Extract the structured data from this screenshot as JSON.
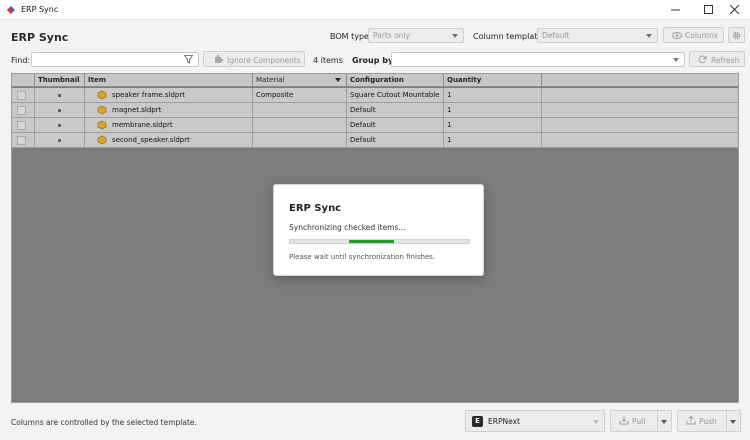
{
  "window": {
    "title": "ERP Sync"
  },
  "header": {
    "app_title": "ERP Sync",
    "bom_type_label": "BOM type:",
    "bom_type_value": "Parts only",
    "column_template_label": "Column template:",
    "column_template_value": "Default",
    "columns_button": "Columns"
  },
  "findbar": {
    "find_label": "Find:",
    "find_value": "",
    "ignore_button": "Ignore Components",
    "item_count": "4 items",
    "group_by_label": "Group by:",
    "group_by_value": "",
    "refresh_button": "Refresh"
  },
  "table": {
    "columns": [
      "Thumbnail",
      "Item",
      "Material",
      "Configuration",
      "Quantity"
    ],
    "rows": [
      {
        "item": "speaker frame.sldprt",
        "material": "Composite",
        "configuration": "Square Cutout Mountable",
        "quantity": "1"
      },
      {
        "item": "magnet.sldprt",
        "material": "",
        "configuration": "Default",
        "quantity": "1"
      },
      {
        "item": "membrane.sldprt",
        "material": "",
        "configuration": "Default",
        "quantity": "1"
      },
      {
        "item": "second_speaker.sldprt",
        "material": "",
        "configuration": "Default",
        "quantity": "1"
      }
    ]
  },
  "dialog": {
    "title": "ERP Sync",
    "message": "Synchronizing checked items...",
    "progress_start": 0.33,
    "progress_end": 0.58,
    "note": "Please wait until synchronization finishes."
  },
  "footer": {
    "note": "Columns are controlled by the selected template.",
    "erp_name": "ERPNext",
    "pull_button": "Pull",
    "push_button": "Push"
  },
  "colors": {
    "progress": "#1fa02a",
    "table_bg": "#7d7d7d"
  },
  "icons": [
    "erp-sync-app-icon",
    "filter-icon",
    "puzzle-icon",
    "eye-icon",
    "gear-icon",
    "refresh-icon",
    "part-icon",
    "erpnext-logo",
    "pull-icon",
    "push-icon"
  ]
}
